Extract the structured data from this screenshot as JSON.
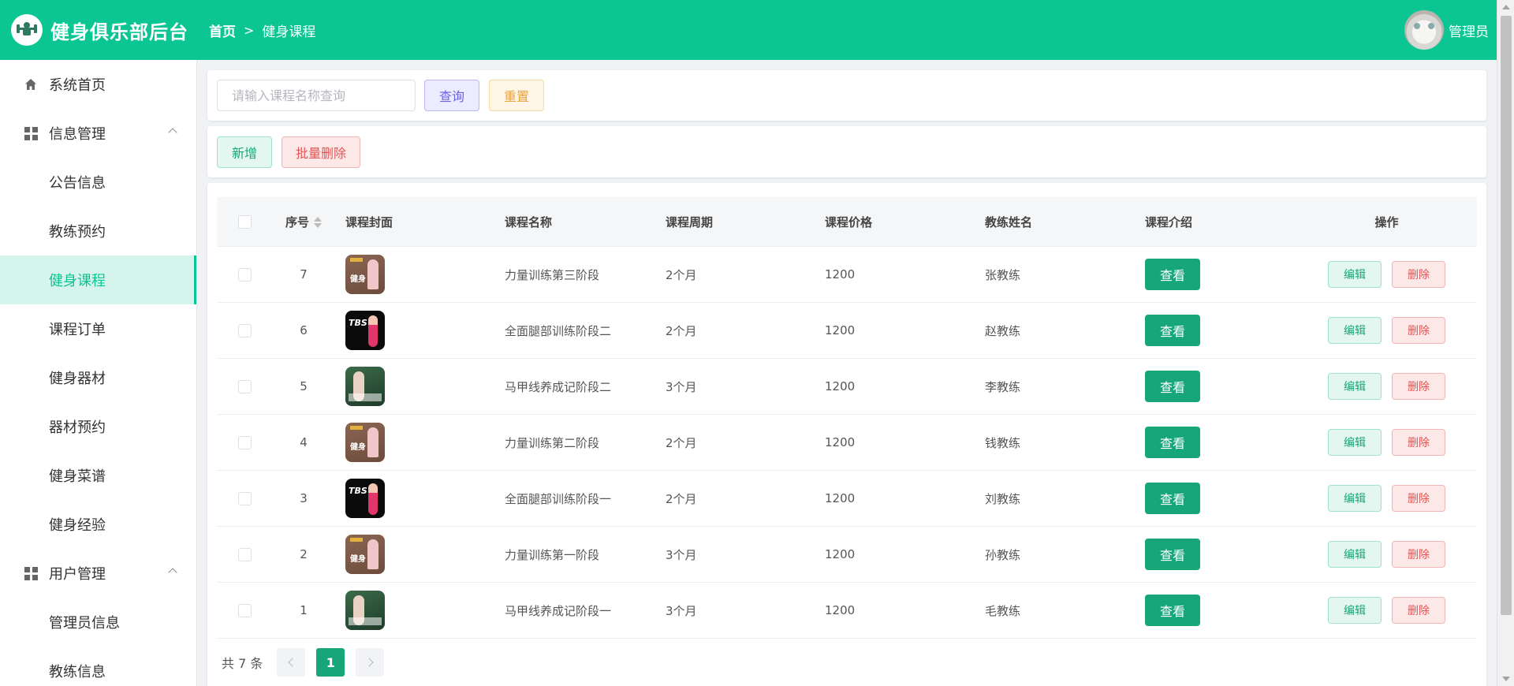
{
  "header": {
    "app_title": "健身俱乐部后台",
    "breadcrumb": {
      "home": "首页",
      "separator": ">",
      "current": "健身课程"
    },
    "user_name": "管理员",
    "brand_color": "#0bc693"
  },
  "sidebar": {
    "items": [
      {
        "label": "系统首页",
        "level": "top",
        "icon": "home-icon"
      },
      {
        "label": "信息管理",
        "level": "top",
        "icon": "grid-icon",
        "expanded": true
      },
      {
        "label": "公告信息",
        "level": "sub"
      },
      {
        "label": "教练预约",
        "level": "sub"
      },
      {
        "label": "健身课程",
        "level": "sub",
        "active": true
      },
      {
        "label": "课程订单",
        "level": "sub"
      },
      {
        "label": "健身器材",
        "level": "sub"
      },
      {
        "label": "器材预约",
        "level": "sub"
      },
      {
        "label": "健身菜谱",
        "level": "sub"
      },
      {
        "label": "健身经验",
        "level": "sub"
      },
      {
        "label": "用户管理",
        "level": "top",
        "icon": "grid-icon",
        "expanded": true
      },
      {
        "label": "管理员信息",
        "level": "sub"
      },
      {
        "label": "教练信息",
        "level": "sub"
      }
    ]
  },
  "search": {
    "placeholder": "请输入课程名称查询",
    "value": "",
    "query_label": "查询",
    "reset_label": "重置"
  },
  "actions": {
    "add_label": "新增",
    "batch_delete_label": "批量删除"
  },
  "table": {
    "columns": {
      "index": "序号",
      "cover": "课程封面",
      "name": "课程名称",
      "period": "课程周期",
      "price": "课程价格",
      "coach": "教练姓名",
      "intro": "课程介绍",
      "ops": "操作"
    },
    "view_label": "查看",
    "edit_label": "编辑",
    "delete_label": "删除",
    "rows": [
      {
        "index": "7",
        "cover": "brown",
        "cover_text": "健身",
        "name": "力量训练第三阶段",
        "period": "2个月",
        "price": "1200",
        "coach": "张教练"
      },
      {
        "index": "6",
        "cover": "black",
        "cover_text": "",
        "name": "全面腿部训练阶段二",
        "period": "2个月",
        "price": "1200",
        "coach": "赵教练"
      },
      {
        "index": "5",
        "cover": "green",
        "cover_text": "",
        "name": "马甲线养成记阶段二",
        "period": "3个月",
        "price": "1200",
        "coach": "李教练"
      },
      {
        "index": "4",
        "cover": "brown",
        "cover_text": "健身",
        "name": "力量训练第二阶段",
        "period": "2个月",
        "price": "1200",
        "coach": "钱教练"
      },
      {
        "index": "3",
        "cover": "black",
        "cover_text": "",
        "name": "全面腿部训练阶段一",
        "period": "2个月",
        "price": "1200",
        "coach": "刘教练"
      },
      {
        "index": "2",
        "cover": "brown",
        "cover_text": "健身",
        "name": "力量训练第一阶段",
        "period": "3个月",
        "price": "1200",
        "coach": "孙教练"
      },
      {
        "index": "1",
        "cover": "green",
        "cover_text": "",
        "name": "马甲线养成记阶段一",
        "period": "3个月",
        "price": "1200",
        "coach": "毛教练"
      }
    ]
  },
  "pagination": {
    "total_text": "共 7 条",
    "current_page": "1"
  }
}
